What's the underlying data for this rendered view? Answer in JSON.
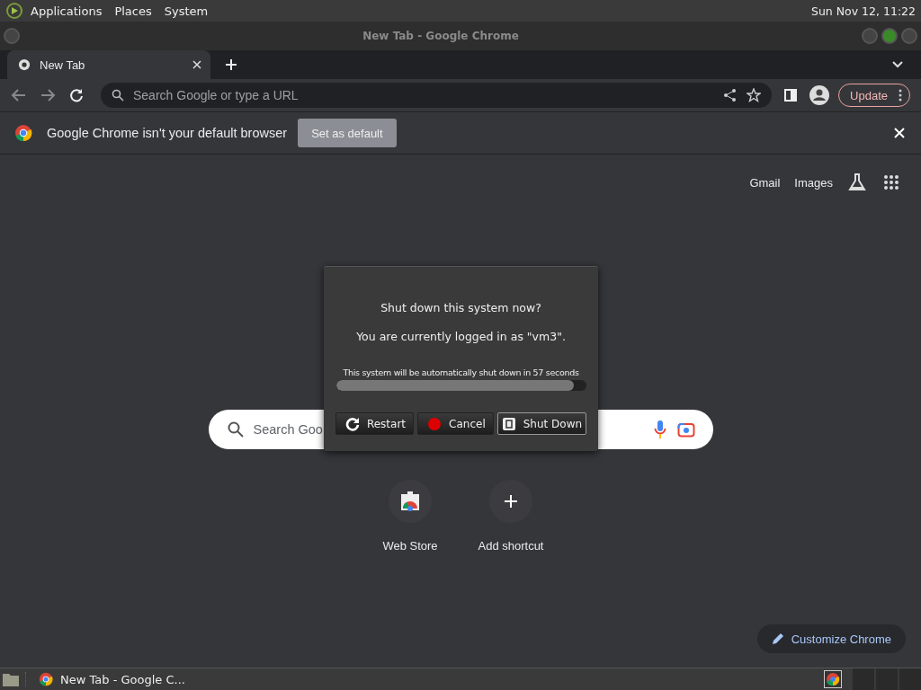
{
  "top_panel": {
    "menus": [
      "Applications",
      "Places",
      "System"
    ],
    "clock": "Sun Nov 12, 11:22"
  },
  "window": {
    "title": "New Tab - Google Chrome"
  },
  "tabs": [
    {
      "label": "New Tab",
      "selected": true
    }
  ],
  "toolbar": {
    "address_placeholder": "Search Google or type a URL",
    "update_label": "Update"
  },
  "infobar": {
    "message": "Google Chrome isn't your default browser",
    "button": "Set as default"
  },
  "new_tab_page": {
    "links": [
      "Gmail",
      "Images"
    ],
    "search_placeholder": "Search Goo",
    "shortcuts": [
      {
        "label": "Web Store",
        "kind": "store"
      },
      {
        "label": "Add shortcut",
        "kind": "add"
      }
    ],
    "customize": "Customize Chrome"
  },
  "dialog": {
    "question": "Shut down this system now?",
    "logged_in": "You are currently logged in as \"vm3\".",
    "countdown": "This system will be automatically shut down in 57 seconds",
    "level": 0.95,
    "buttons": [
      {
        "label": "Restart",
        "kind": "restart",
        "selected": false
      },
      {
        "label": "Cancel",
        "kind": "cancel",
        "selected": false
      },
      {
        "label": "Shut Down",
        "kind": "shutdown",
        "selected": true
      }
    ]
  },
  "taskbar": {
    "windows": [
      {
        "label": "New Tab - Google C...",
        "selected": false
      }
    ]
  }
}
